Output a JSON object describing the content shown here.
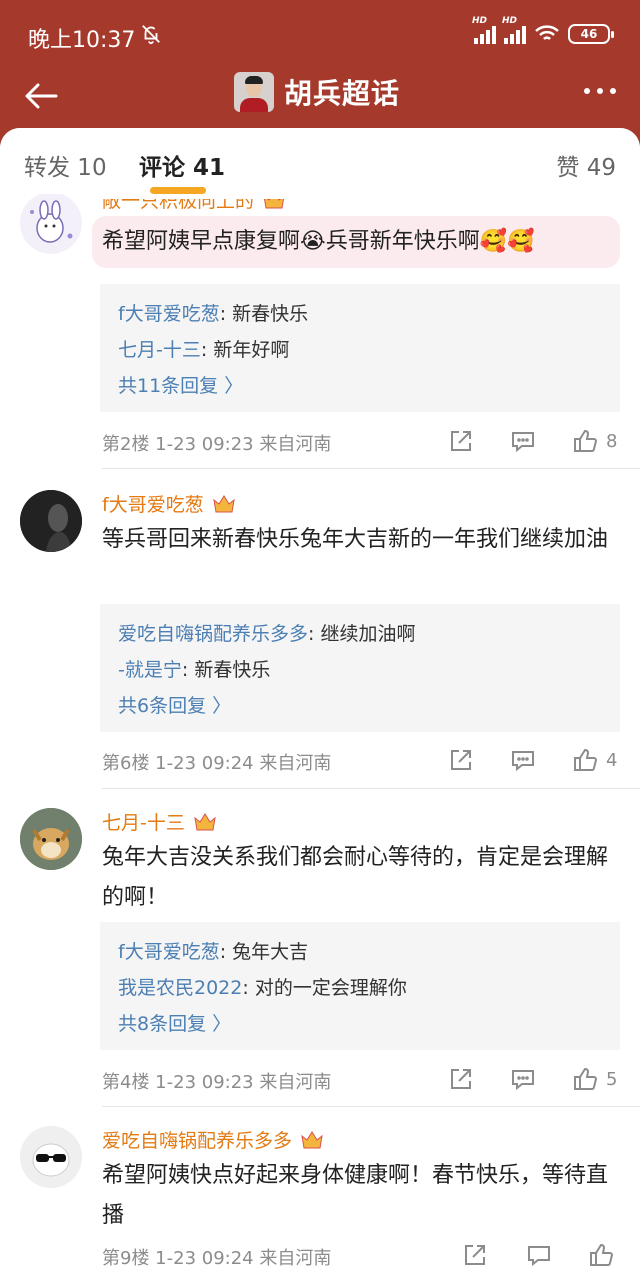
{
  "status": {
    "time": "晚上10:37",
    "battery": "46",
    "hd1": "HD",
    "hd2": "HD"
  },
  "header": {
    "title": "胡兵超话"
  },
  "tabs": {
    "repost": "转发 10",
    "comments": "评论 41",
    "likes": "赞 49"
  },
  "comments": [
    {
      "name": "敞一只积极向上的",
      "text": "希望阿姨早点康复啊😭兵哥新年快乐啊🥰🥰",
      "replies": [
        {
          "user": "f大哥爱吃葱",
          "text": "新春快乐"
        },
        {
          "user": "七月-十三",
          "text": "新年好啊"
        }
      ],
      "more": "共11条回复 〉",
      "meta": "第2楼  1-23 09:23  来自河南",
      "likes": "8"
    },
    {
      "name": "f大哥爱吃葱",
      "text": "等兵哥回来新春快乐兔年大吉新的一年我们继续加油",
      "replies": [
        {
          "user": "爱吃自嗨锅配养乐多多",
          "text": "继续加油啊"
        },
        {
          "user": "-就是宁",
          "text": "新春快乐"
        }
      ],
      "more": "共6条回复 〉",
      "meta": "第6楼  1-23 09:24  来自河南",
      "likes": "4"
    },
    {
      "name": "七月-十三",
      "text": "兔年大吉没关系我们都会耐心等待的，肯定是会理解的啊！",
      "replies": [
        {
          "user": "f大哥爱吃葱",
          "text": "兔年大吉"
        },
        {
          "user": "我是农民2022",
          "text": "对的一定会理解你"
        }
      ],
      "more": "共8条回复 〉",
      "meta": "第4楼  1-23 09:23  来自河南",
      "likes": "5"
    },
    {
      "name": "爱吃自嗨锅配养乐多多",
      "text": "希望阿姨快点好起来身体健康啊！春节快乐，等待直播",
      "meta": "第9楼  1-23 09:24  来自河南"
    }
  ],
  "icons": {
    "back": "arrow-left-icon",
    "more": "ellipsis-icon",
    "share": "share-icon",
    "reply": "comment-icon",
    "like": "thumbs-up-icon",
    "crown": "crown-badge-icon"
  },
  "colors": {
    "header": "#a53a2c",
    "username": "#e47a12",
    "link": "#4c7fb3",
    "tab_indicator": "#f5a623"
  }
}
